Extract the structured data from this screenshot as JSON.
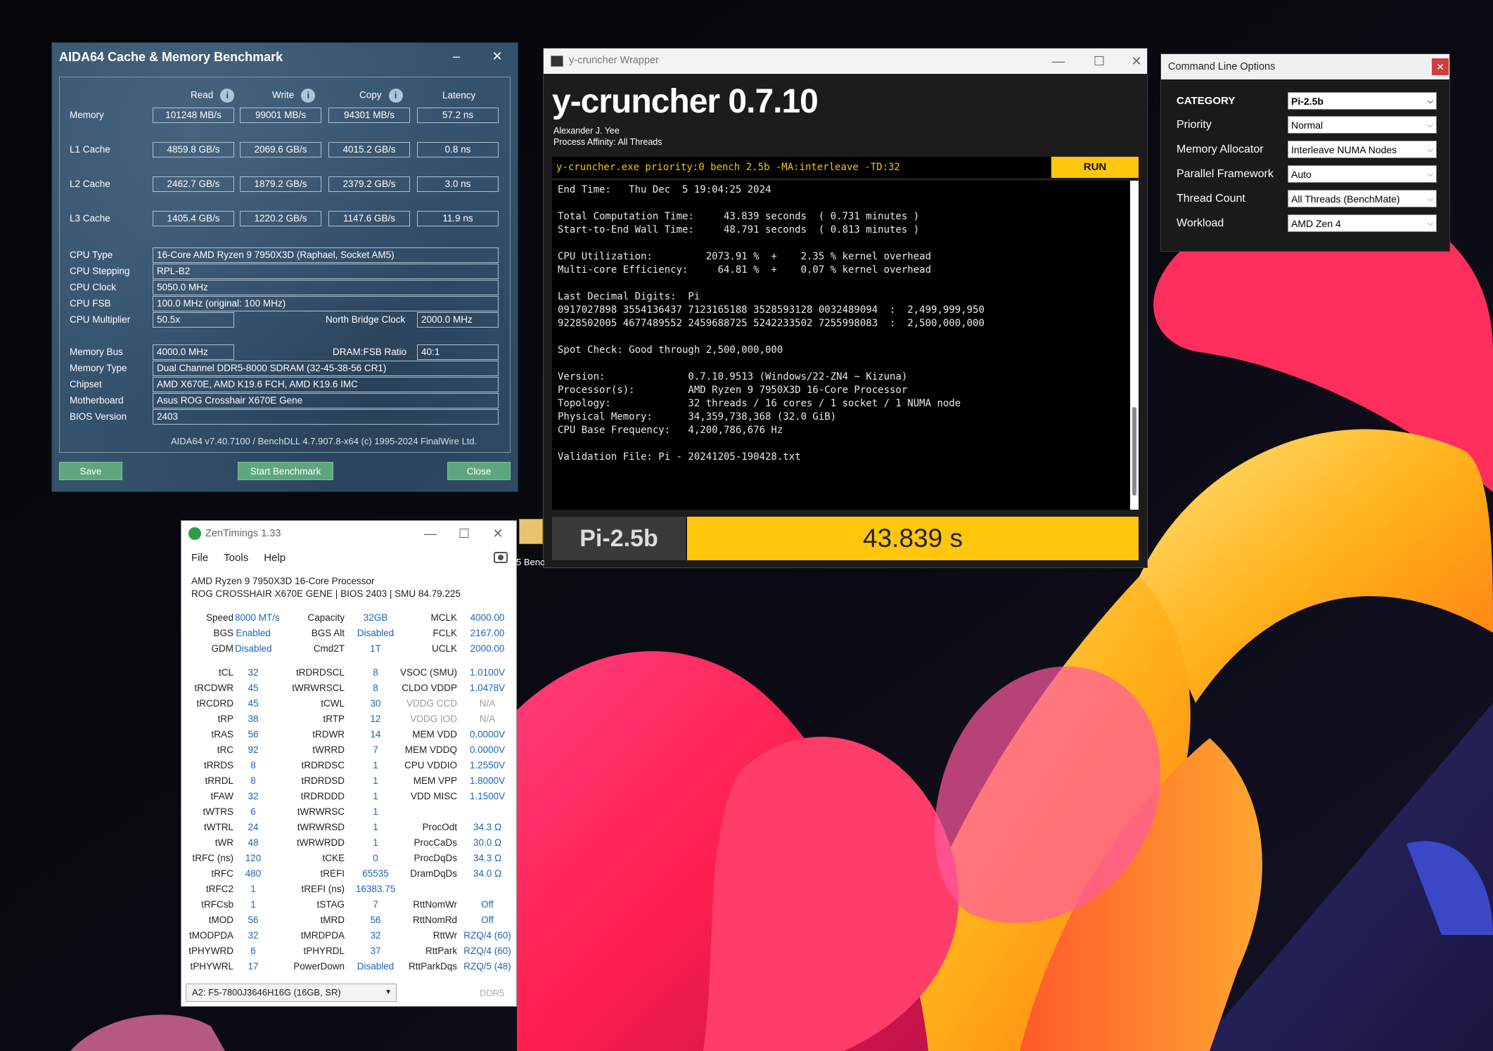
{
  "aida": {
    "title": "AIDA64 Cache & Memory Benchmark",
    "col_read": "Read",
    "col_write": "Write",
    "col_copy": "Copy",
    "col_latency": "Latency",
    "rows": [
      {
        "label": "Memory",
        "read": "101248 MB/s",
        "write": "99001 MB/s",
        "copy": "94301 MB/s",
        "latency": "57.2 ns"
      },
      {
        "label": "L1 Cache",
        "read": "4859.8 GB/s",
        "write": "2069.6 GB/s",
        "copy": "4015.2 GB/s",
        "latency": "0.8 ns"
      },
      {
        "label": "L2 Cache",
        "read": "2462.7 GB/s",
        "write": "1879.2 GB/s",
        "copy": "2379.2 GB/s",
        "latency": "3.0 ns"
      },
      {
        "label": "L3 Cache",
        "read": "1405.4 GB/s",
        "write": "1220.2 GB/s",
        "copy": "1147.6 GB/s",
        "latency": "11.9 ns"
      }
    ],
    "cpu_type_label": "CPU Type",
    "cpu_type": "16-Core AMD Ryzen 9 7950X3D  (Raphael, Socket AM5)",
    "cpu_stepping_label": "CPU Stepping",
    "cpu_stepping": "RPL-B2",
    "cpu_clock_label": "CPU Clock",
    "cpu_clock": "5050.0 MHz",
    "cpu_fsb_label": "CPU FSB",
    "cpu_fsb": "100.0 MHz  (original: 100 MHz)",
    "cpu_mult_label": "CPU Multiplier",
    "cpu_mult": "50.5x",
    "nb_clock_label": "North Bridge Clock",
    "nb_clock": "2000.0 MHz",
    "mem_bus_label": "Memory Bus",
    "mem_bus": "4000.0 MHz",
    "dram_fsb_label": "DRAM:FSB Ratio",
    "dram_fsb": "40:1",
    "mem_type_label": "Memory Type",
    "mem_type": "Dual Channel DDR5-8000 SDRAM  (32-45-38-56 CR1)",
    "chipset_label": "Chipset",
    "chipset": "AMD X670E, AMD K19.6 FCH, AMD K19.6 IMC",
    "mobo_label": "Motherboard",
    "mobo": "Asus ROG Crosshair X670E Gene",
    "bios_label": "BIOS Version",
    "bios": "2403",
    "footer": "AIDA64 v7.40.7100 / BenchDLL 4.7.907.8-x64  (c) 1995-2024 FinalWire Ltd.",
    "save": "Save",
    "start": "Start Benchmark",
    "close": "Close"
  },
  "yc": {
    "window_title": "y-cruncher Wrapper",
    "heading": "y-cruncher 0.7.10",
    "author": "Alexander J. Yee",
    "affinity": "Process Affinity: All Threads",
    "command": "y-cruncher.exe priority:0 bench 2.5b -MA:interleave -TD:32",
    "run": "RUN",
    "output": "End Time:   Thu Dec  5 19:04:25 2024\n\nTotal Computation Time:     43.839 seconds  ( 0.731 minutes )\nStart-to-End Wall Time:     48.791 seconds  ( 0.813 minutes )\n\nCPU Utilization:         2073.91 %  +    2.35 % kernel overhead\nMulti-core Efficiency:     64.81 %  +    0.07 % kernel overhead\n\nLast Decimal Digits:  Pi\n0917027898 3554136437 7123165188 3528593128 0032489094  :  2,499,999,950\n9228502005 4677489552 2459688725 5242233502 7255998083  :  2,500,000,000\n\nSpot Check: Good through 2,500,000,000\n\nVersion:              0.7.10.9513 (Windows/22-ZN4 ~ Kizuna)\nProcessor(s):         AMD Ryzen 9 7950X3D 16-Core Processor\nTopology:             32 threads / 16 cores / 1 socket / 1 NUMA node\nPhysical Memory:      34,359,738,368 (32.0 GiB)\nCPU Base Frequency:   4,200,786,676 Hz\n\nValidation File: Pi - 20241205-190428.txt",
    "bench_name": "Pi-2.5b",
    "bench_time": "43.839 s"
  },
  "clo": {
    "title": "Command Line Options",
    "rows": [
      {
        "label": "CATEGORY",
        "value": "Pi-2.5b"
      },
      {
        "label": "Priority",
        "value": "Normal"
      },
      {
        "label": "Memory Allocator",
        "value": "Interleave NUMA Nodes"
      },
      {
        "label": "Parallel Framework",
        "value": "Auto"
      },
      {
        "label": "Thread Count",
        "value": "All Threads (BenchMate)"
      },
      {
        "label": "Workload",
        "value": "AMD Zen 4"
      }
    ]
  },
  "zt": {
    "title": "ZenTimings 1.33",
    "menu_file": "File",
    "menu_tools": "Tools",
    "menu_help": "Help",
    "cpu": "AMD Ryzen 9 7950X3D 16-Core Processor",
    "board": "ROG CROSSHAIR X670E GENE | BIOS 2403 | SMU 84.79.225",
    "top": [
      [
        "Speed",
        "8000 MT/s",
        "Capacity",
        "32GB",
        "MCLK",
        "4000.00"
      ],
      [
        "BGS",
        "Enabled",
        "BGS Alt",
        "Disabled",
        "FCLK",
        "2167.00"
      ],
      [
        "GDM",
        "Disabled",
        "Cmd2T",
        "1T",
        "UCLK",
        "2000.00"
      ]
    ],
    "timings": [
      [
        "tCL",
        "32",
        "tRDRDSCL",
        "8",
        "VSOC (SMU)",
        "1.0100V"
      ],
      [
        "tRCDWR",
        "45",
        "tWRWRSCL",
        "8",
        "CLDO VDDP",
        "1.0478V"
      ],
      [
        "tRCDRD",
        "45",
        "tCWL",
        "30",
        "VDDG CCD",
        "N/A"
      ],
      [
        "tRP",
        "38",
        "tRTP",
        "12",
        "VDDG IOD",
        "N/A"
      ],
      [
        "tRAS",
        "56",
        "tRDWR",
        "14",
        "MEM VDD",
        "0.0000V"
      ],
      [
        "tRC",
        "92",
        "tWRRD",
        "7",
        "MEM VDDQ",
        "0.0000V"
      ],
      [
        "tRRDS",
        "8",
        "tRDRDSC",
        "1",
        "CPU VDDIO",
        "1.2550V"
      ],
      [
        "tRRDL",
        "8",
        "tRDRDSD",
        "1",
        "MEM VPP",
        "1.8000V"
      ],
      [
        "tFAW",
        "32",
        "tRDRDDD",
        "1",
        "VDD MISC",
        "1.1500V"
      ],
      [
        "tWTRS",
        "6",
        "tWRWRSC",
        "1",
        "",
        ""
      ],
      [
        "tWTRL",
        "24",
        "tWRWRSD",
        "1",
        "ProcOdt",
        "34.3 Ω"
      ],
      [
        "tWR",
        "48",
        "tWRWRDD",
        "1",
        "ProcCaDs",
        "30.0 Ω"
      ],
      [
        "tRFC (ns)",
        "120",
        "tCKE",
        "0",
        "ProcDqDs",
        "34.3 Ω"
      ],
      [
        "tRFC",
        "480",
        "tREFI",
        "65535",
        "DramDqDs",
        "34.0 Ω"
      ],
      [
        "tRFC2",
        "1",
        "tREFI (ns)",
        "16383.75",
        "",
        ""
      ],
      [
        "tRFCsb",
        "1",
        "tSTAG",
        "7",
        "RttNomWr",
        "Off"
      ],
      [
        "tMOD",
        "56",
        "tMRD",
        "56",
        "RttNomRd",
        "Off"
      ],
      [
        "tMODPDA",
        "32",
        "tMRDPDA",
        "32",
        "RttWr",
        "RZQ/4 (60)"
      ],
      [
        "tPHYWRD",
        "6",
        "tPHYRDL",
        "37",
        "RttPark",
        "RZQ/4 (60)"
      ],
      [
        "tPHYWRL",
        "17",
        "PowerDown",
        "Disabled",
        "RttParkDqs",
        "RZQ/5 (48)"
      ]
    ],
    "module": "A2: F5-7800J3646H16G (16GB, SR)",
    "ddr": "DDR5"
  },
  "desktop": {
    "icon_label": "5 Benc"
  }
}
